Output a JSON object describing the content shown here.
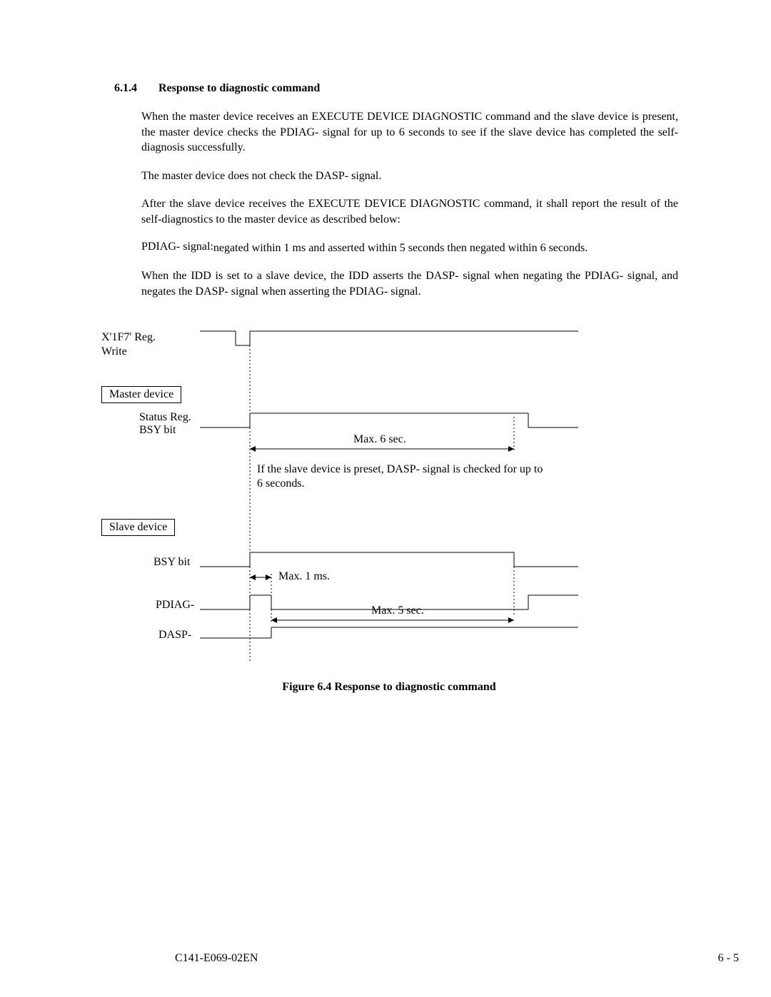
{
  "section": {
    "number": "6.1.4",
    "title": "Response to diagnostic command"
  },
  "paragraphs": {
    "p1": "When the master device receives an EXECUTE DEVICE DIAGNOSTIC command and the slave device is present, the master device checks the PDIAG- signal for up to 6 seconds to see if the slave device has completed the self-diagnosis successfully.",
    "p2": "The master device does not check the DASP- signal.",
    "p3": "After the slave device receives the EXECUTE DEVICE DIAGNOSTIC command, it shall report the result of the self-diagnostics to the master device as described below:",
    "pdiag_label": "PDIAG- signal:",
    "pdiag_text": "negated within 1 ms and asserted within 5 seconds then negated within 6 seconds.",
    "p5": "When the IDD is set to a slave device, the IDD asserts the DASP- signal when negating the PDIAG- signal, and negates the DASP- signal when asserting the PDIAG- signal."
  },
  "diagram": {
    "reg_write_line1": "X'1F7' Reg.",
    "reg_write_line2": "Write",
    "master_box": "Master device",
    "status_reg_line1": "Status Reg.",
    "status_reg_line2": "BSY bit",
    "max6": "Max. 6 sec.",
    "note_line1": "If the slave device is preset, DASP- signal is checked for up to",
    "note_line2": "6 seconds.",
    "slave_box": "Slave device",
    "slave_bsy": "BSY bit",
    "max1ms": "Max. 1 ms.",
    "pdiag": "PDIAG-",
    "max5": "Max. 5 sec.",
    "dasp": "DASP-"
  },
  "figure_caption": "Figure 6.4    Response to diagnostic command",
  "footer": {
    "doc_id": "C141-E069-02EN",
    "page_num": "6 - 5"
  }
}
